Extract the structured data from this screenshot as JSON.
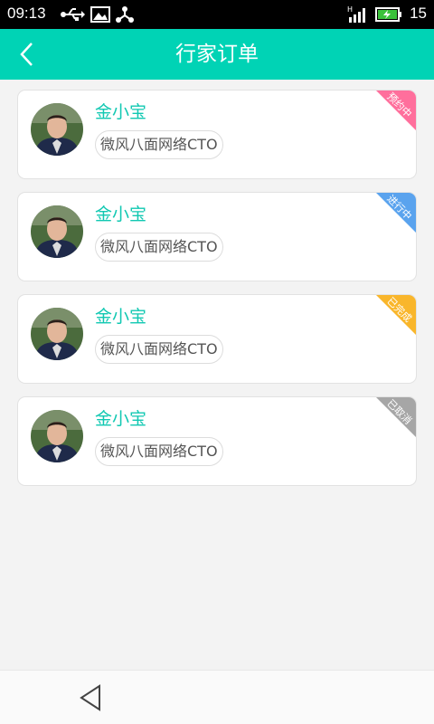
{
  "status_bar": {
    "time": "09:13",
    "battery_level": "15",
    "signal_label": "H",
    "icons": [
      "usb-icon",
      "image-icon",
      "share-icon",
      "signal-icon",
      "battery-charging-icon"
    ]
  },
  "header": {
    "title": "行家订单",
    "back_icon": "chevron-left-icon",
    "color": "#00d3b5"
  },
  "orders": [
    {
      "name": "金小宝",
      "tag": "微风八面网络CTO",
      "status": "预约中",
      "status_color": "#ff6f9c"
    },
    {
      "name": "金小宝",
      "tag": "微风八面网络CTO",
      "status": "进行中",
      "status_color": "#5aa3ee"
    },
    {
      "name": "金小宝",
      "tag": "微风八面网络CTO",
      "status": "已完成",
      "status_color": "#f9b62b"
    },
    {
      "name": "金小宝",
      "tag": "微风八面网络CTO",
      "status": "已取消",
      "status_color": "#a6a6a6"
    }
  ],
  "nav": {
    "back_icon": "triangle-back-icon"
  }
}
